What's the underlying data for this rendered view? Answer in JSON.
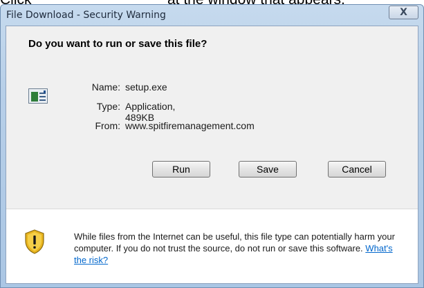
{
  "instruction": {
    "lead": "Click",
    "tail": "at the window that appears."
  },
  "window": {
    "title": "File Download - Security Warning",
    "close_glyph": "X"
  },
  "dialog": {
    "question": "Do you want to run or save this file?",
    "fields": [
      {
        "label": "Name:",
        "value": "setup.exe"
      },
      {
        "label": "Type:",
        "value": "Application, 489KB"
      },
      {
        "label": "From:",
        "value": "www.spitfiremanagement.com"
      }
    ],
    "buttons": {
      "run": "Run",
      "save": "Save",
      "cancel": "Cancel"
    },
    "warning": {
      "text": "While files from the Internet can be useful, this file type can potentially harm your computer. If you do not trust the source, do not run or save this software.",
      "link": "What's the risk?"
    }
  },
  "icons": {
    "file": "application-file-icon",
    "shield": "security-shield-warning-icon",
    "close": "close-icon"
  },
  "colors": {
    "title_bar": "#b7cfe8",
    "link": "#0066cc",
    "shield_gold": "#e8b41e"
  }
}
